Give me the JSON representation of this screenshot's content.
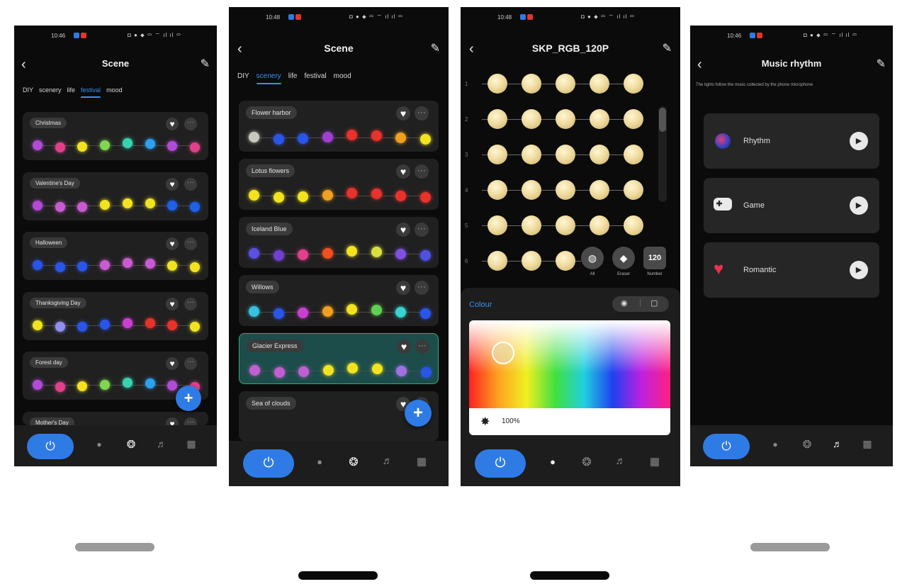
{
  "screens": {
    "s1": {
      "time": "10:46",
      "status_icons": "◘ ● ⬥ ▭ ⌔ ıl ıl ▭",
      "title": "Scene",
      "tabs": [
        "DIY",
        "scenery",
        "life",
        "festival",
        "mood"
      ],
      "active_tab": "festival",
      "scenes": [
        {
          "name": "Christmas",
          "colors": [
            "#b14bd6",
            "#e0408c",
            "#f2e321",
            "#7fd650",
            "#38d4b0",
            "#2ea0f0",
            "#b14bd6",
            "#e0408c"
          ]
        },
        {
          "name": "Valentine's Day",
          "colors": [
            "#b14bd6",
            "#c95bd0",
            "#c95bd0",
            "#f2e321",
            "#f2e321",
            "#f2e321",
            "#2060e8",
            "#2060e8"
          ]
        },
        {
          "name": "Halloween",
          "colors": [
            "#2a55e8",
            "#2a55e8",
            "#2a55e8",
            "#c95bd0",
            "#c95bd0",
            "#c95bd0",
            "#f2e321",
            "#f2e321"
          ]
        },
        {
          "name": "Thanksgiving Day",
          "colors": [
            "#f2e321",
            "#9090ee",
            "#2a55e8",
            "#2a55e8",
            "#c940d0",
            "#e8322c",
            "#e8322c",
            "#f2e321"
          ]
        },
        {
          "name": "Forest day",
          "colors": [
            "#b14bd6",
            "#e0408c",
            "#f2e321",
            "#7fd650",
            "#38d4b0",
            "#2ea0f0",
            "#b14bd6",
            "#e0408c"
          ]
        },
        {
          "name": "Mother's Day",
          "colors": []
        }
      ],
      "fab": "+"
    },
    "s2": {
      "time": "10:48",
      "status_icons": "◘ ● ⬥ ▭ ⌔ ıl ıl ▭",
      "title": "Scene",
      "tabs": [
        "DIY",
        "scenery",
        "life",
        "festival",
        "mood"
      ],
      "active_tab": "scenery",
      "scenes": [
        {
          "name": "Flower harbor",
          "colors": [
            "#c8c8c0",
            "#2a55e8",
            "#2a55e8",
            "#a040d0",
            "#e8322c",
            "#e8322c",
            "#f0a020",
            "#f2e321"
          ]
        },
        {
          "name": "Lotus flowers",
          "colors": [
            "#f2e321",
            "#f2e321",
            "#f2e321",
            "#f0a020",
            "#e8322c",
            "#e8322c",
            "#e8322c",
            "#e8322c"
          ]
        },
        {
          "name": "Iceland Blue",
          "colors": [
            "#5a50e0",
            "#7040d0",
            "#e0408c",
            "#f05020",
            "#f2e321",
            "#d8e040",
            "#8050e0",
            "#5050e0"
          ]
        },
        {
          "name": "Willows",
          "colors": [
            "#38c0e0",
            "#2a55e8",
            "#c940d0",
            "#f0a020",
            "#f2e321",
            "#60d050",
            "#38d4d0",
            "#2a55e8"
          ]
        },
        {
          "name": "Glacier Express",
          "colors": [
            "#c060d0",
            "#c060d0",
            "#c060d0",
            "#f2e321",
            "#f2e321",
            "#f2e321",
            "#a070e0",
            "#2a55e8"
          ]
        },
        {
          "name": "Sea of clouds",
          "colors": []
        }
      ],
      "selected_index": 4,
      "fab": "+"
    },
    "s3": {
      "time": "10:48",
      "status_icons": "◘ ● ⬥ ▭ ⌔ ıl ıl ▭",
      "title": "SKP_RGB_120P",
      "row_numbers": [
        "1",
        "2",
        "3",
        "4",
        "5",
        "6"
      ],
      "tools": [
        {
          "label": "All"
        },
        {
          "label": "Eraser"
        },
        {
          "label": "Number",
          "value": "120"
        }
      ],
      "panel_title": "Colour",
      "brightness": "100%"
    },
    "s4": {
      "time": "10:46",
      "status_icons": "◘ ● ⬥ ▭ ⌔ ıl ıl ▭",
      "title": "Music rhythm",
      "subtitle": "The lights follow the music collected by the phone microphone",
      "modes": [
        {
          "label": "Rhythm",
          "icon": "rhythm-icon"
        },
        {
          "label": "Game",
          "icon": "gamepad-icon"
        },
        {
          "label": "Romantic",
          "icon": "hearts-icon"
        }
      ]
    }
  },
  "nav_icons": [
    "power-icon",
    "bulb-icon",
    "palette-icon",
    "music-icon",
    "timer-icon"
  ],
  "glyphs": {
    "power": "⏻",
    "back": "‹",
    "edit": "✎",
    "heart": "♥",
    "more": "···",
    "bulb": "●",
    "palette": "❂",
    "music": "♬",
    "timer": "▦",
    "play": "▶",
    "sun": "✸"
  },
  "colors": {
    "accent": "#2f7be6",
    "tab_active": "#3a8ff0"
  }
}
